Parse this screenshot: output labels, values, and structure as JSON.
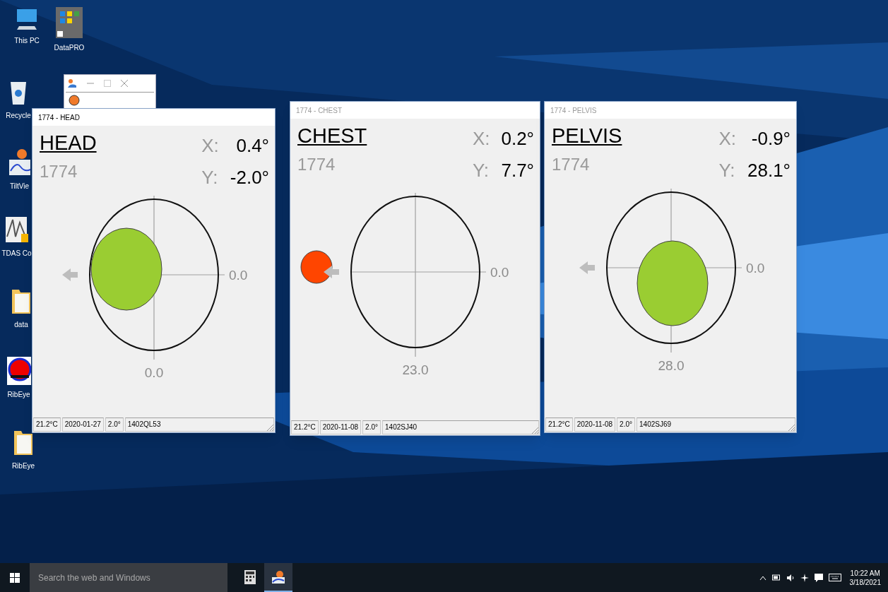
{
  "desktop": {
    "icons": [
      {
        "kind": "pc",
        "label": "This PC"
      },
      {
        "kind": "tiles",
        "label": "DataPRO"
      },
      {
        "kind": "bin",
        "label": "Recycle"
      },
      {
        "kind": "chart",
        "label": "TiltVie"
      },
      {
        "kind": "wave",
        "label": "TDAS Co"
      },
      {
        "kind": "folder",
        "label": "data"
      },
      {
        "kind": "ribeye",
        "label": "RibEye"
      },
      {
        "kind": "folder",
        "label": "RibEye"
      }
    ]
  },
  "windows": [
    {
      "title": "1774 - HEAD",
      "active": true,
      "name": "HEAD",
      "serial": "1774",
      "x_label": "X:",
      "x_value": "0.4°",
      "y_label": "Y:",
      "y_value": "-2.0°",
      "right_reading": "0.0",
      "bottom_reading": "0.0",
      "indicator": {
        "color": "#9acd32"
      },
      "status": [
        "21.2°C",
        "2020-01-27",
        "2.0°",
        "1402QL53"
      ]
    },
    {
      "title": "1774 - CHEST",
      "active": false,
      "name": "CHEST",
      "serial": "1774",
      "x_label": "X:",
      "x_value": "0.2°",
      "y_label": "Y:",
      "y_value": "7.7°",
      "right_reading": "0.0",
      "bottom_reading": "23.0",
      "indicator": {
        "color": "#ff4500"
      },
      "status": [
        "21.2°C",
        "2020-11-08",
        "2.0°",
        "1402SJ40"
      ]
    },
    {
      "title": "1774 - PELVIS",
      "active": false,
      "name": "PELVIS",
      "serial": "1774",
      "x_label": "X:",
      "x_value": "-0.9°",
      "y_label": "Y:",
      "y_value": "28.1°",
      "right_reading": "0.0",
      "bottom_reading": "28.0",
      "indicator": {
        "color": "#9acd32"
      },
      "status": [
        "21.2°C",
        "2020-11-08",
        "2.0°",
        "1402SJ69"
      ]
    }
  ],
  "taskbar": {
    "search": {
      "placeholder": "Search the web and Windows"
    },
    "apps": [
      {
        "kind": "calculator",
        "selected": false
      },
      {
        "kind": "tilt",
        "selected": true
      }
    ],
    "clock": {
      "time": "10:22 AM",
      "date": "3/18/2021"
    }
  }
}
